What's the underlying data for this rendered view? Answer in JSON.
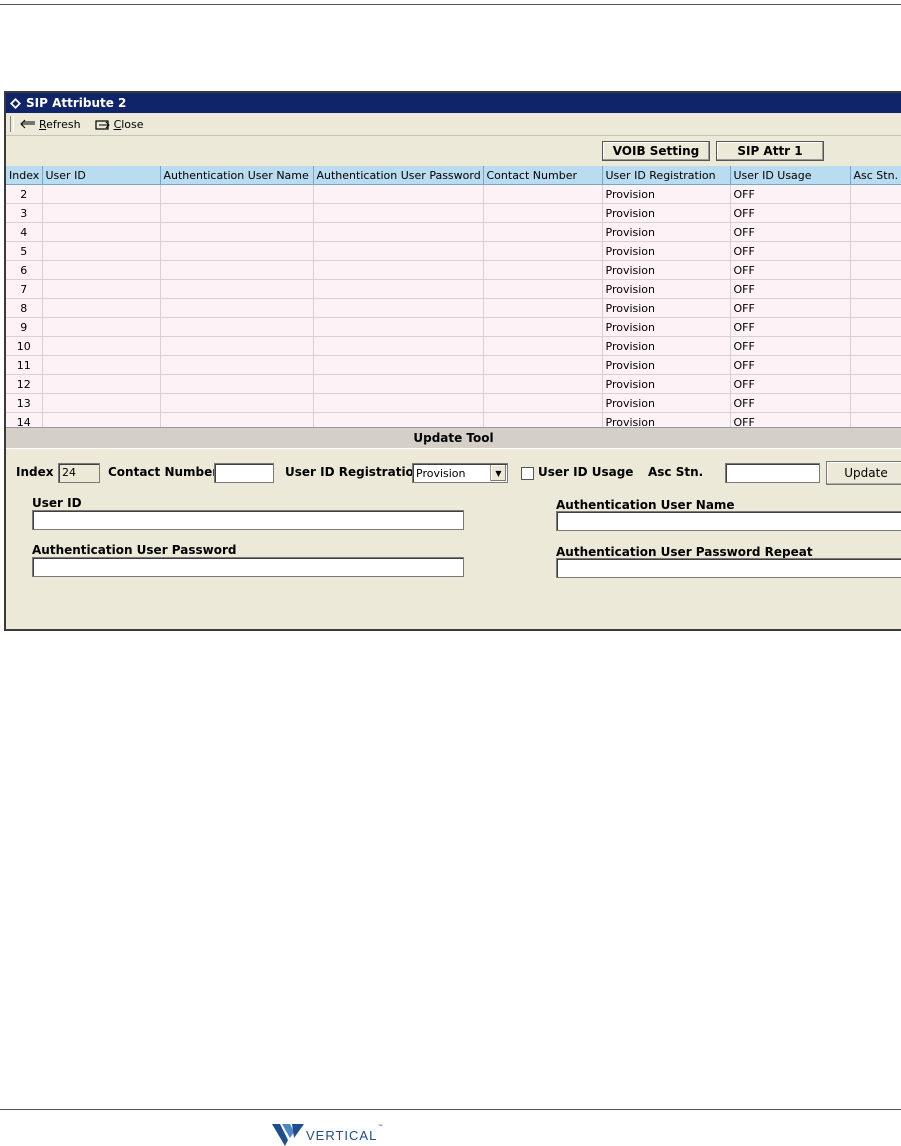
{
  "window": {
    "title": "SIP Attribute 2",
    "toolbar": {
      "refresh_label": "Refresh",
      "close_label": "Close"
    },
    "buttons": {
      "voib_setting": "VOIB Setting",
      "sip_attr_1": "SIP Attr 1"
    }
  },
  "table": {
    "headers": [
      "Index",
      "User ID",
      "Authentication User Name",
      "Authentication User Password",
      "Contact Number",
      "User ID Registration",
      "User ID Usage",
      "Asc Stn."
    ],
    "rows": [
      [
        "2",
        "",
        "",
        "",
        "",
        "Provision",
        "OFF",
        ""
      ],
      [
        "3",
        "",
        "",
        "",
        "",
        "Provision",
        "OFF",
        ""
      ],
      [
        "4",
        "",
        "",
        "",
        "",
        "Provision",
        "OFF",
        ""
      ],
      [
        "5",
        "",
        "",
        "",
        "",
        "Provision",
        "OFF",
        ""
      ],
      [
        "6",
        "",
        "",
        "",
        "",
        "Provision",
        "OFF",
        ""
      ],
      [
        "7",
        "",
        "",
        "",
        "",
        "Provision",
        "OFF",
        ""
      ],
      [
        "8",
        "",
        "",
        "",
        "",
        "Provision",
        "OFF",
        ""
      ],
      [
        "9",
        "",
        "",
        "",
        "",
        "Provision",
        "OFF",
        ""
      ],
      [
        "10",
        "",
        "",
        "",
        "",
        "Provision",
        "OFF",
        ""
      ],
      [
        "11",
        "",
        "",
        "",
        "",
        "Provision",
        "OFF",
        ""
      ],
      [
        "12",
        "",
        "",
        "",
        "",
        "Provision",
        "OFF",
        ""
      ],
      [
        "13",
        "",
        "",
        "",
        "",
        "Provision",
        "OFF",
        ""
      ],
      [
        "14",
        "",
        "",
        "",
        "",
        "Provision",
        "OFF",
        ""
      ]
    ]
  },
  "update_tool": {
    "header": "Update Tool",
    "index_label": "Index",
    "index_value": "24",
    "contact_number_label": "Contact Number",
    "contact_number_value": "",
    "registration_label": "User ID Registration",
    "registration_value": "Provision",
    "usage_label": "User ID Usage",
    "usage_checked": false,
    "asc_stn_label": "Asc Stn.",
    "asc_stn_value": "",
    "update_button": "Update",
    "user_id_label": "User ID",
    "user_id_value": "",
    "auth_user_name_label": "Authentication User Name",
    "auth_user_name_value": "",
    "auth_password_label": "Authentication User Password",
    "auth_password_value": "",
    "auth_password_repeat_label": "Authentication User Password Repeat",
    "auth_password_repeat_value": ""
  },
  "footer": {
    "logo_text": "VERTICAL",
    "logo_mark": "™"
  },
  "colors": {
    "titlebar": "#10246a",
    "grid_header": "#b9dcf0",
    "grid_row": "#fdf2f5",
    "logo_blue": "#1f4e8c"
  }
}
